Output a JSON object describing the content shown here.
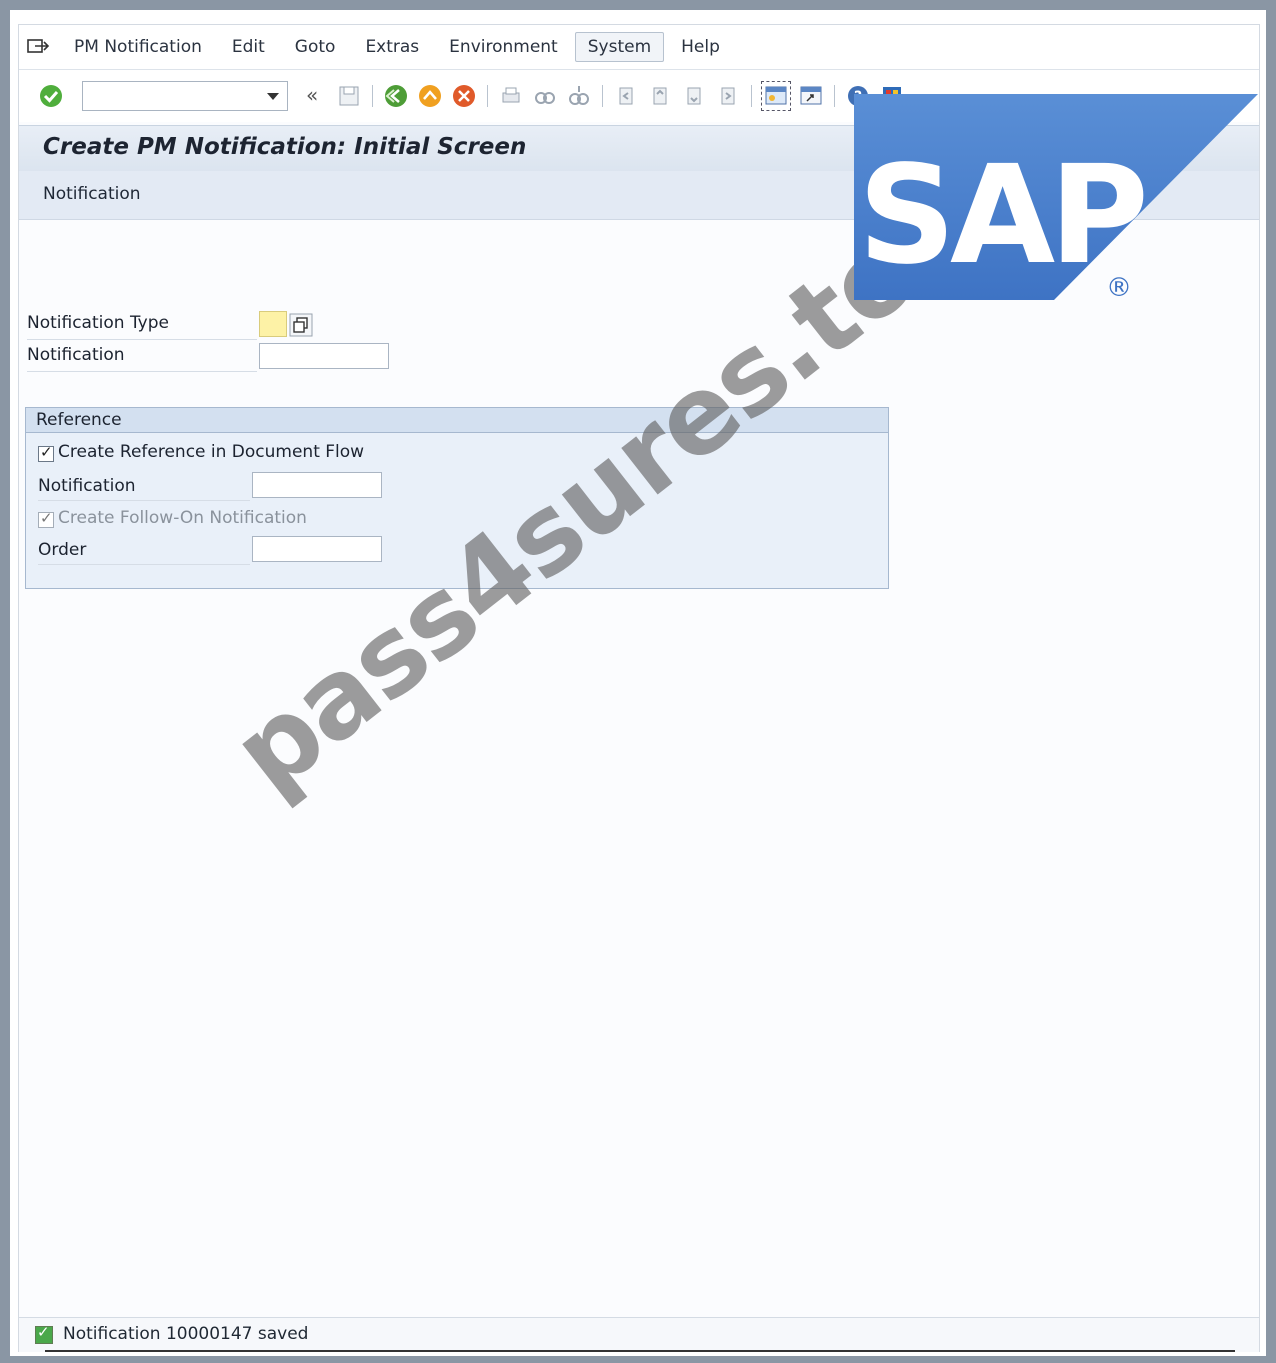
{
  "menubar": {
    "items": [
      "PM Notification",
      "Edit",
      "Goto",
      "Extras",
      "Environment",
      "System",
      "Help"
    ],
    "active_item": "System"
  },
  "toolbar": {
    "command_field_value": "",
    "icons": [
      "enter-icon",
      "back-arrows-icon",
      "save-icon",
      "back-icon",
      "exit-icon",
      "cancel-icon",
      "print-icon",
      "find-icon",
      "find-next-icon",
      "first-page-icon",
      "previous-page-icon",
      "next-page-icon",
      "last-page-icon",
      "create-session-icon",
      "shortcut-icon",
      "help-icon",
      "layout-icon"
    ]
  },
  "header": {
    "title": "Create PM Notification: Initial Screen",
    "app_toolbar_item": "Notification"
  },
  "form": {
    "notification_type_label": "Notification Type",
    "notification_type_value": "",
    "notification_label": "Notification",
    "notification_value": ""
  },
  "reference": {
    "title": "Reference",
    "create_reference_label": "Create Reference in Document Flow",
    "create_reference_checked": true,
    "notification_label": "Notification",
    "notification_value": "",
    "follow_on_label": "Create Follow-On Notification",
    "follow_on_checked": true,
    "order_label": "Order",
    "order_value": ""
  },
  "overlay": {
    "logo_text": "SAP",
    "registered_mark": "®",
    "watermark": "pass4sures.top"
  },
  "status": {
    "message": "Notification 10000147 saved",
    "type": "success"
  },
  "colors": {
    "title_bg": "#dbe4ef",
    "group_bg": "#e9f0f9",
    "required_field": "#fdf2a6",
    "sap_blue": "#4a7fd0",
    "success": "#4aa84a"
  }
}
